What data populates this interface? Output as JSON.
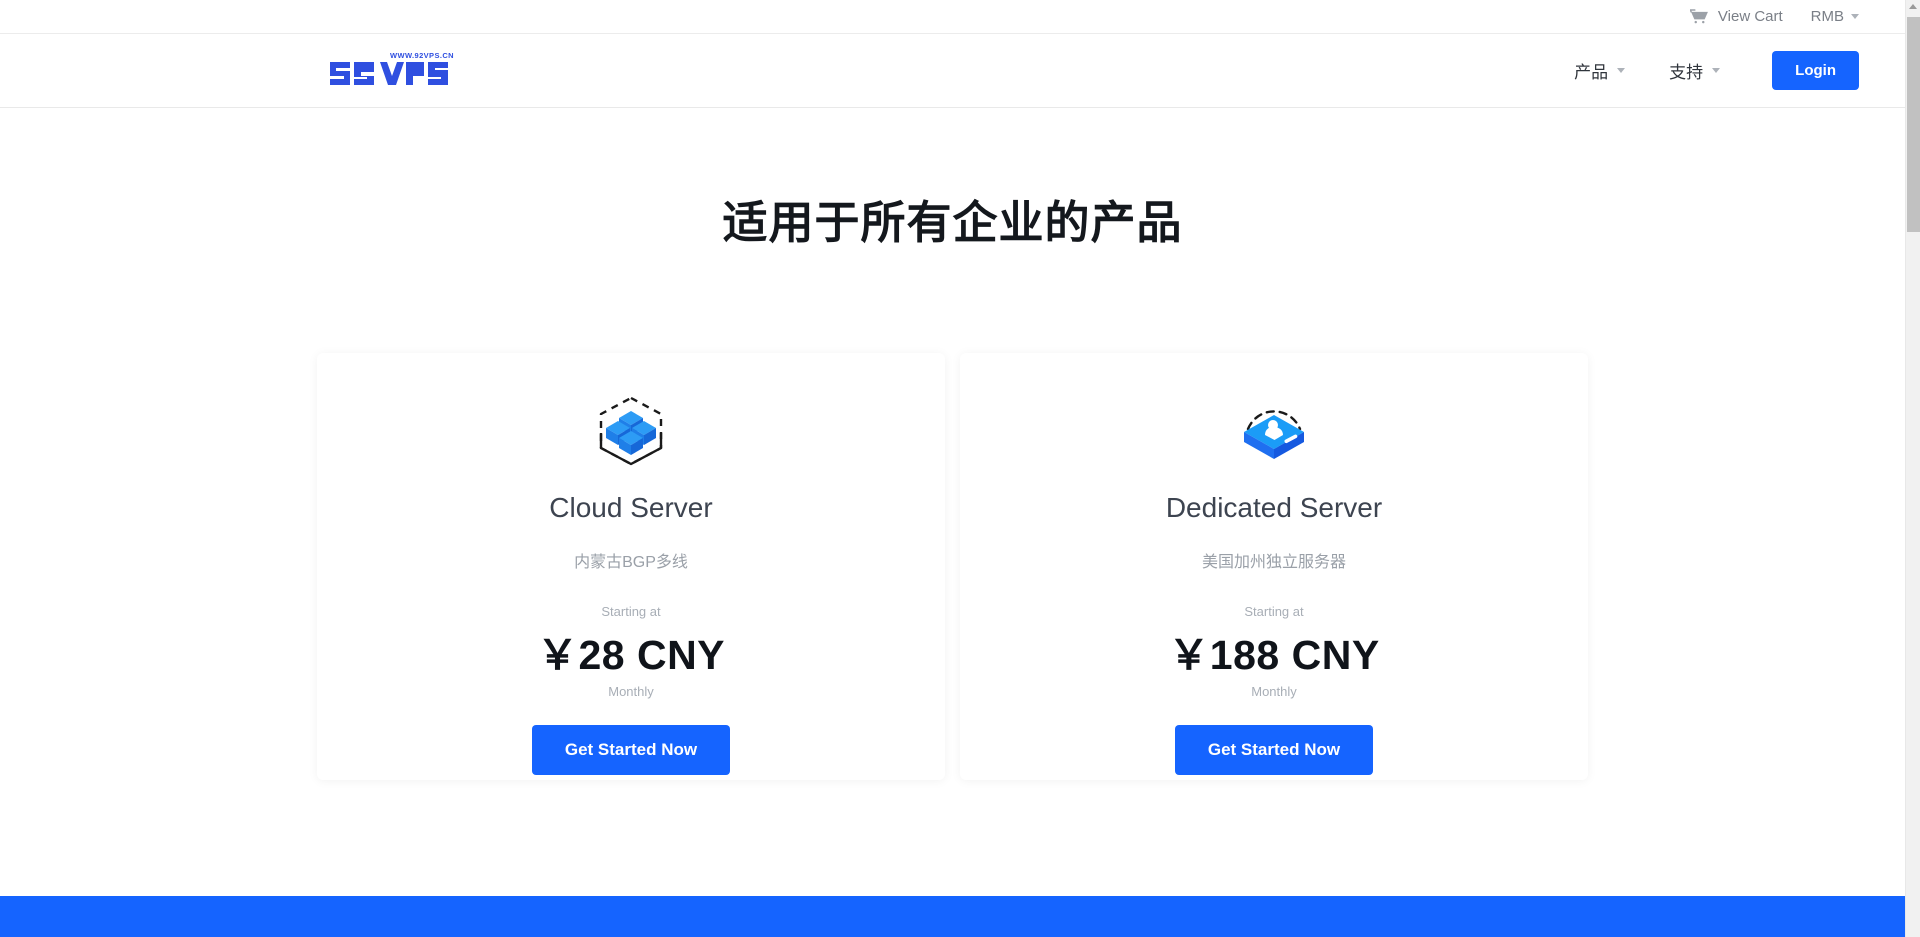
{
  "topbar": {
    "cart_label": "View Cart",
    "cart_icon": "shopping-cart-icon",
    "currency_label": "RMB",
    "currency_caret": "chevron-down-icon"
  },
  "header": {
    "logo_text": "92VPS",
    "logo_tagline": "WWW.92VPS.CN",
    "nav": [
      {
        "label": "产品",
        "caret": "chevron-down-icon"
      },
      {
        "label": "支持",
        "caret": "chevron-down-icon"
      }
    ],
    "login_label": "Login"
  },
  "main": {
    "title": "适用于所有企业的产品",
    "cards": [
      {
        "icon": "cloud-server-cubes-icon",
        "title": "Cloud Server",
        "subtitle": "内蒙古BGP多线",
        "price_prefix": "Starting at",
        "price": "￥28 CNY",
        "price_suffix": "Monthly",
        "cta_label": "Get Started Now"
      },
      {
        "icon": "dedicated-server-box-icon",
        "title": "Dedicated Server",
        "subtitle": "美国加州独立服务器",
        "price_prefix": "Starting at",
        "price": "￥188 CNY",
        "price_suffix": "Monthly",
        "cta_label": "Get Started Now"
      }
    ]
  },
  "colors": {
    "brand_blue": "#1564ff",
    "icon_blue_light": "#2196f3",
    "icon_blue_dark": "#1565f0",
    "text_dark": "#14181d",
    "text_muted": "#9aa0a8",
    "footer_band": "#1564ff"
  }
}
